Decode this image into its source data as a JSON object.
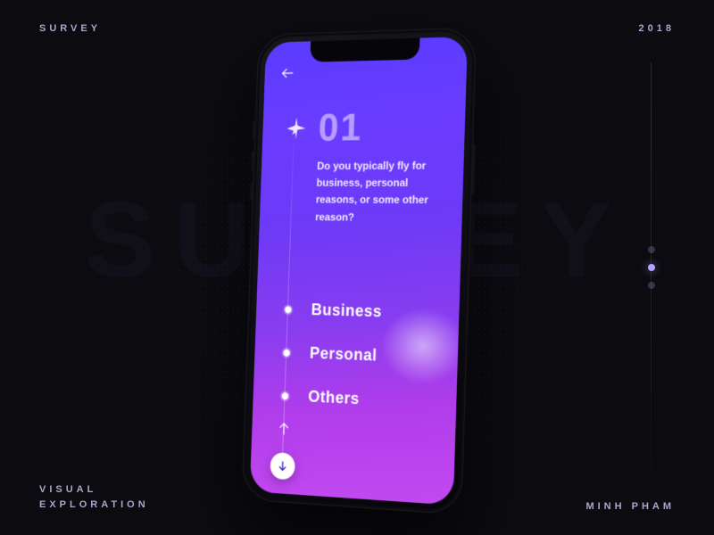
{
  "meta": {
    "title": "SURVEY",
    "year": "2018",
    "footer_left_line1": "VISUAL",
    "footer_left_line2": "EXPLORATION",
    "footer_right": "MINH PHAM",
    "watermark": "SURVEY"
  },
  "pager": {
    "total": 3,
    "active_index": 1
  },
  "survey": {
    "question_number": "01",
    "icon": "airplane",
    "question": "Do you typically fly for business, personal reasons, or some other reason?",
    "options": [
      {
        "label": "Business"
      },
      {
        "label": "Personal"
      },
      {
        "label": "Others"
      }
    ],
    "controls": {
      "back": "←",
      "prev": "↑",
      "next": "↓"
    }
  },
  "colors": {
    "bg": "#0b0b10",
    "accent_top": "#5a3dff",
    "accent_bottom": "#c24af0",
    "text_light": "#e7e6f7"
  }
}
